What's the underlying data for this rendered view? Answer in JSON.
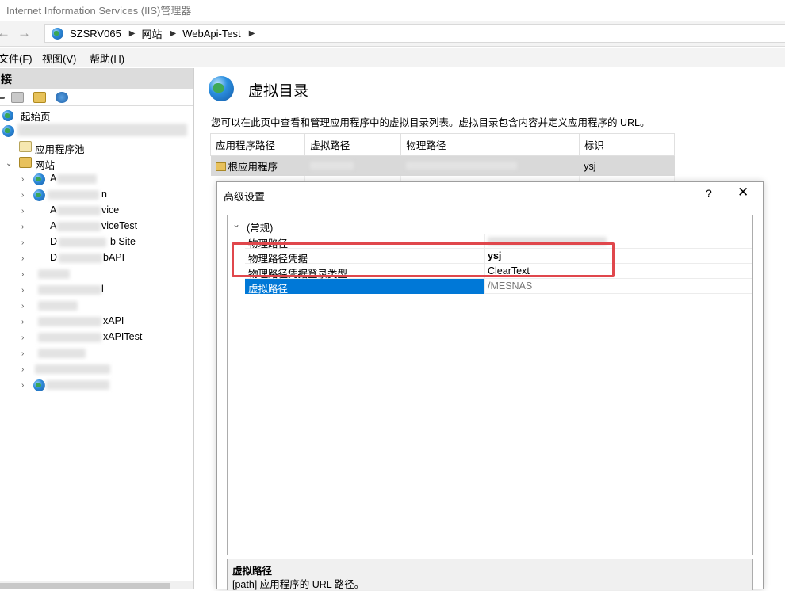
{
  "window": {
    "title": "Internet Information Services (IIS)管理器"
  },
  "address": {
    "crumbs": [
      "SZSRV065",
      "网站",
      "WebApi-Test"
    ]
  },
  "menu": {
    "items": [
      "文件(F)",
      "视图(V)",
      "帮助(H)"
    ]
  },
  "connections": {
    "title": "接",
    "tree": [
      {
        "label": "起始页"
      },
      {
        "label": "应用程序池"
      },
      {
        "label": "网站"
      }
    ],
    "sites_visible_fragments": [
      "A",
      "n",
      "A",
      "vice",
      "A",
      "viceTest",
      "D",
      "b Site",
      "D",
      "bAPI",
      "l",
      "xAPI",
      "xAPITest"
    ]
  },
  "main": {
    "title": "虚拟目录",
    "description": "您可以在此页中查看和管理应用程序中的虚拟目录列表。虚拟目录包含内容并定义应用程序的 URL。",
    "table": {
      "headers": [
        "应用程序路径",
        "虚拟路径",
        "物理路径",
        "标识"
      ],
      "rows": [
        {
          "app": "根应用程序",
          "vpath": "",
          "ppath": "",
          "identity": "ysj"
        }
      ]
    }
  },
  "dialog": {
    "title": "高级设置",
    "help": "?",
    "close": "✕",
    "category": "(常规)",
    "properties": [
      {
        "name": "物理路径",
        "value": ""
      },
      {
        "name": "物理路径凭据",
        "value": "ysj"
      },
      {
        "name": "物理路径凭据登录类型",
        "value": "ClearText"
      },
      {
        "name": "虚拟路径",
        "value": "/MESNAS"
      }
    ],
    "help_title": "虚拟路径",
    "help_text": "[path] 应用程序的 URL 路径。"
  },
  "colors": {
    "selection": "#0078d7",
    "highlight_box": "#e0474c"
  }
}
